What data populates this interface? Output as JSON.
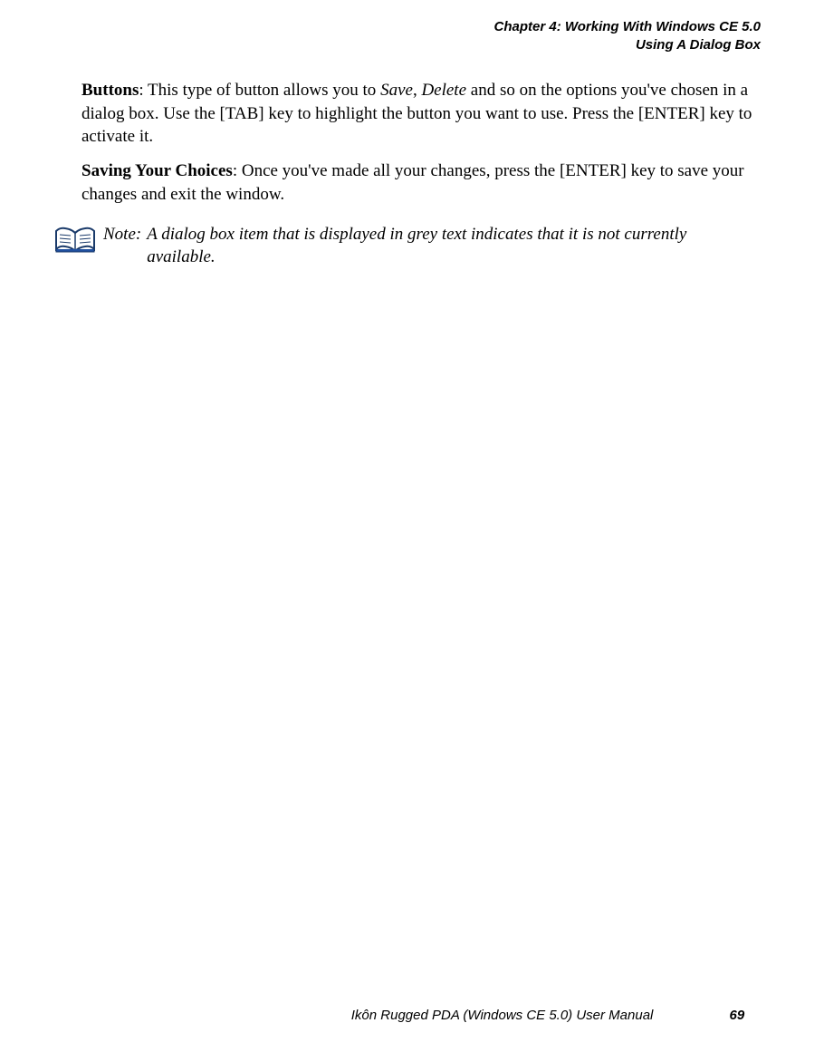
{
  "header": {
    "line1": "Chapter 4: Working With Windows CE 5.0",
    "line2": "Using A Dialog Box"
  },
  "paragraphs": {
    "p1_lead": "Buttons",
    "p1_rest_a": ": This type of button allows you to ",
    "p1_italic1": "Save",
    "p1_mid": ", ",
    "p1_italic2": "Delete",
    "p1_rest_b": " and so on the options you've chosen in a dialog box. Use the [TAB] key to highlight the button you want to use. Press the [ENTER] key to activate it.",
    "p2_lead": "Saving Your Choices",
    "p2_rest": ": Once you've made all your changes, press the [ENTER] key to save your changes and exit the window."
  },
  "note": {
    "label": "Note:",
    "content": "A dialog box item that is displayed in grey text indicates that it is not currently available."
  },
  "footer": {
    "title": "Ikôn Rugged PDA (Windows CE 5.0) User Manual",
    "page": "69"
  }
}
